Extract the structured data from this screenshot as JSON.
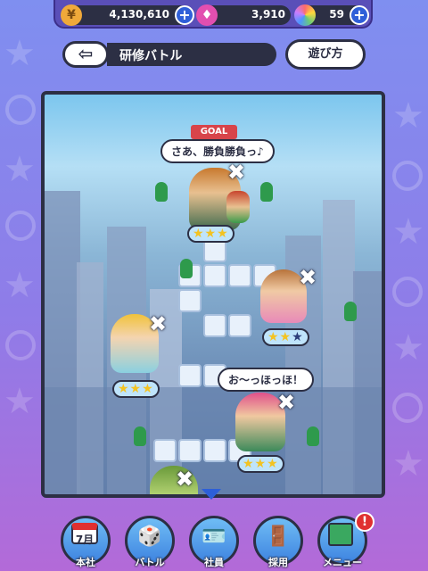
{
  "currency": {
    "coins": "4,130,610",
    "energy": "3,910",
    "gems": "59"
  },
  "header": {
    "title": "研修バトル",
    "howto_label": "遊び方"
  },
  "board": {
    "goal_label": "GOAL",
    "speech_top": "さあ、勝負勝負っ♪",
    "speech_bottom": "お～っほっほ！"
  },
  "nav": {
    "calendar_month": "7月",
    "items": [
      "本社",
      "バトル",
      "社員",
      "採用",
      "メニュー"
    ],
    "menu_badge": "!"
  },
  "colors": {
    "accent": "#2c2f44",
    "star": "#f3c322",
    "nav_button": "#3e83e0"
  }
}
